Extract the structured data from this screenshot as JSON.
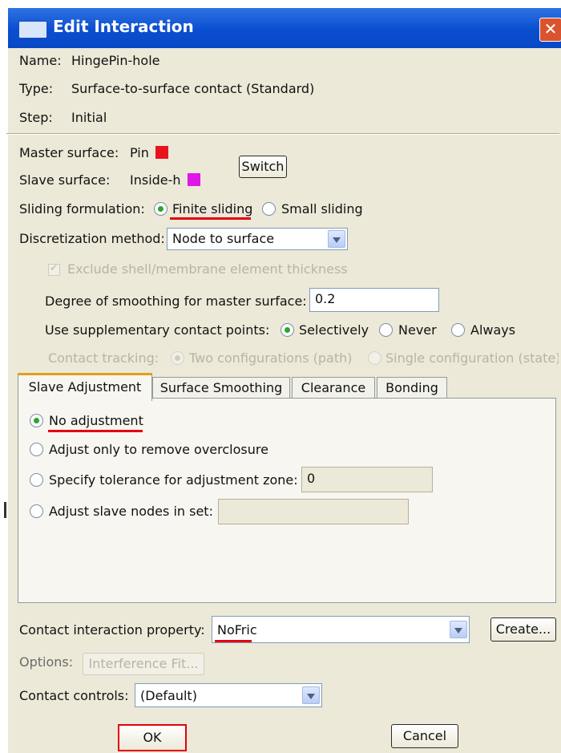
{
  "window": {
    "title": "Edit Interaction",
    "close_glyph": "✕"
  },
  "info": {
    "name_label": "Name:",
    "name_value": "HingePin-hole",
    "type_label": "Type:",
    "type_value": "Surface-to-surface contact (Standard)",
    "step_label": "Step:",
    "step_value": "Initial"
  },
  "surfaces": {
    "master_label": "Master surface:",
    "master_value": "Pin",
    "master_color": "#e8141c",
    "slave_label": "Slave surface:",
    "slave_value": "Inside-h",
    "slave_color": "#e017e6",
    "switch_label": "Switch"
  },
  "sliding": {
    "label": "Sliding formulation:",
    "finite": "Finite sliding",
    "small": "Small sliding",
    "selected": "finite"
  },
  "discretization": {
    "label": "Discretization method:",
    "value": "Node to surface",
    "exclude_label": "Exclude shell/membrane element thickness",
    "smoothing_label": "Degree of smoothing for master surface:",
    "smoothing_value": "0.2",
    "supp_label": "Use supplementary contact points:",
    "supp_selectively": "Selectively",
    "supp_never": "Never",
    "supp_always": "Always",
    "tracking_label": "Contact tracking:",
    "tracking_two": "Two configurations (path)",
    "tracking_single": "Single configuration (state)"
  },
  "tabs": [
    "Slave Adjustment",
    "Surface Smoothing",
    "Clearance",
    "Bonding"
  ],
  "slave_adjust": {
    "no_adjust": "No adjustment",
    "overclosure": "Adjust only to remove overclosure",
    "tolerance": "Specify tolerance for adjustment zone:",
    "tolerance_value": "0",
    "nodes_in_set": "Adjust slave nodes in set:"
  },
  "property": {
    "label": "Contact interaction property:",
    "value": "NoFric",
    "create_label": "Create..."
  },
  "options": {
    "label": "Options:",
    "button": "Interference Fit..."
  },
  "controls": {
    "label": "Contact controls:",
    "value": "(Default)"
  },
  "footer": {
    "ok": "OK",
    "cancel": "Cancel"
  },
  "highlight_color": "#e4000f"
}
